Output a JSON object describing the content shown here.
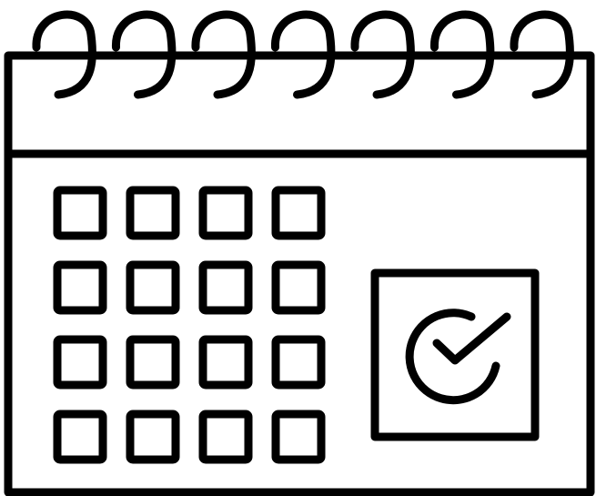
{
  "icon": {
    "name": "calendar-check-icon",
    "style": "line-art",
    "stroke_color": "#000000",
    "background_color": "#ffffff",
    "binding_rings": 7,
    "date_grid": {
      "rows": 4,
      "columns": 4
    },
    "highlight": "checked-date-icon"
  }
}
